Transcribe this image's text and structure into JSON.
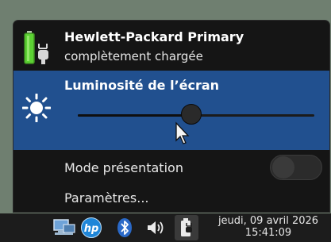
{
  "battery": {
    "name": "Hewlett-Packard Primary",
    "status": "complètement chargée"
  },
  "brightness": {
    "label": "Luminosité de l’écran",
    "level_fraction": 0.48
  },
  "presentation": {
    "label": "Mode présentation",
    "enabled": false
  },
  "settings": {
    "label": "Paramètres..."
  },
  "taskbar": {
    "icons": [
      "network-icon",
      "hp-icon",
      "bluetooth-icon",
      "volume-icon",
      "battery-icon"
    ],
    "clock_date": "jeudi, 09 avril 2026",
    "clock_time": "15:41:09"
  },
  "colors": {
    "accent": "#21508f",
    "battery_green": "#5cd233"
  }
}
